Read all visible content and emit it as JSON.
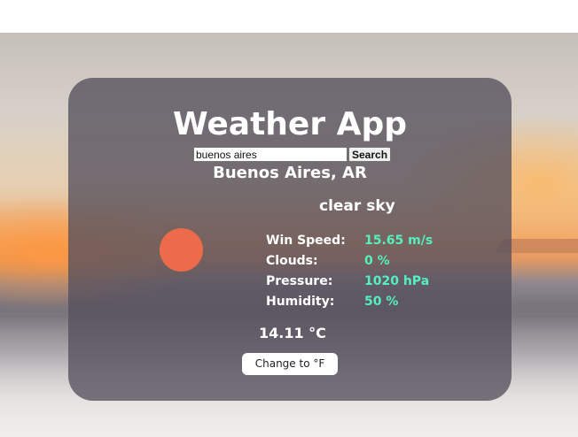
{
  "app": {
    "title": "Weather App"
  },
  "search": {
    "value": "buenos aires",
    "button_label": "Search"
  },
  "weather": {
    "city": "Buenos Aires, AR",
    "description": "clear sky",
    "icon": "sun-icon",
    "stats": [
      {
        "label": "Win Speed:",
        "value": "15.65 m/s"
      },
      {
        "label": "Clouds:",
        "value": "0 %"
      },
      {
        "label": "Pressure:",
        "value": "1020 hPa"
      },
      {
        "label": "Humidity:",
        "value": "50 %"
      }
    ],
    "temperature": "14.11 °C",
    "toggle_label": "Change to °F"
  },
  "colors": {
    "accent_value": "#56f0c0",
    "sun": "#ec6b4b",
    "card": "#55505c"
  }
}
